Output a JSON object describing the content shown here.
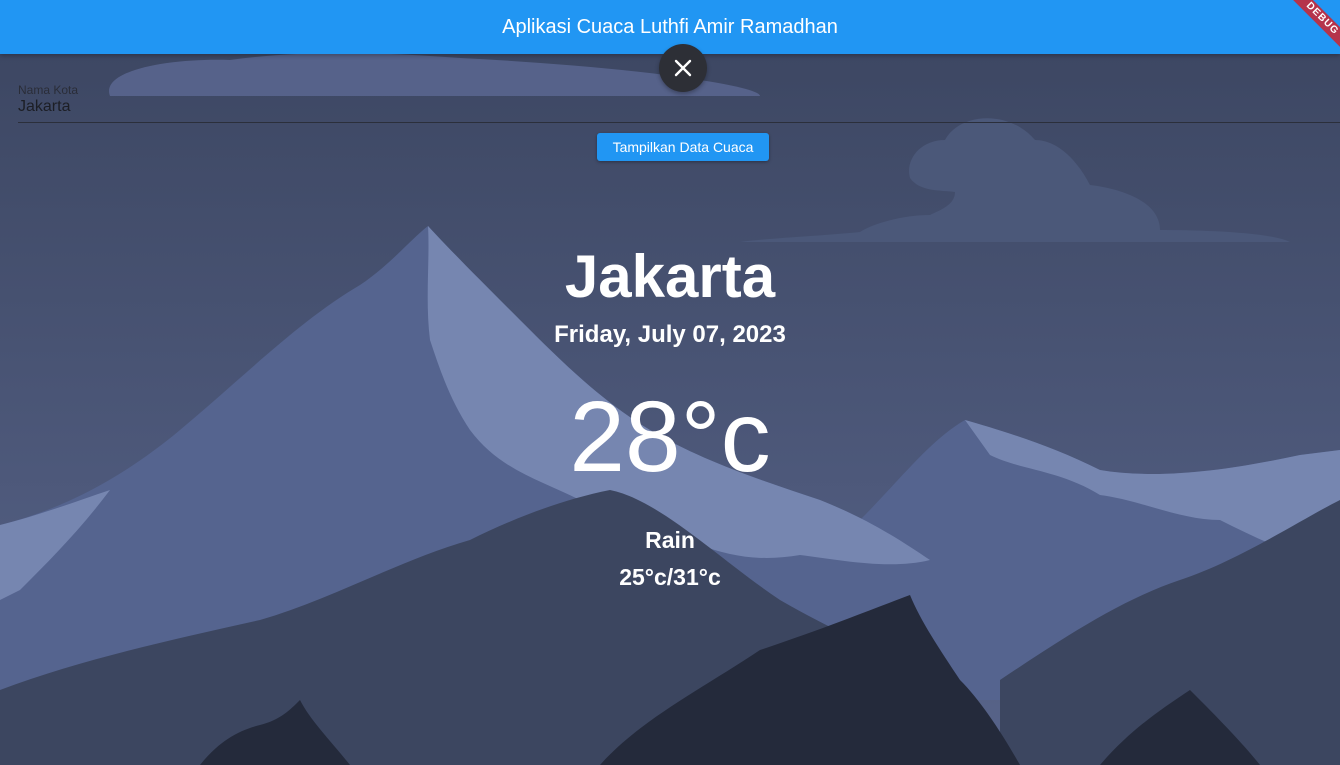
{
  "appbar": {
    "title": "Aplikasi Cuaca Luthfi Amir Ramadhan",
    "debug_banner": "DEBUG"
  },
  "icons": {
    "close": "close-icon"
  },
  "form": {
    "city_label": "Nama Kota",
    "city_value": "Jakarta",
    "submit_label": "Tampilkan Data Cuaca"
  },
  "weather": {
    "city": "Jakarta",
    "date": "Friday, July 07, 2023",
    "temperature": "28°c",
    "condition": "Rain",
    "range": "25°c/31°c"
  },
  "colors": {
    "primary": "#2196f3",
    "sky_top": "#3b4560",
    "sky_bottom": "#58648a",
    "mountain_light": "#7686b0",
    "mountain_mid": "#55648f",
    "mountain_dark": "#3c4660",
    "mountain_darkest": "#242a3b"
  }
}
